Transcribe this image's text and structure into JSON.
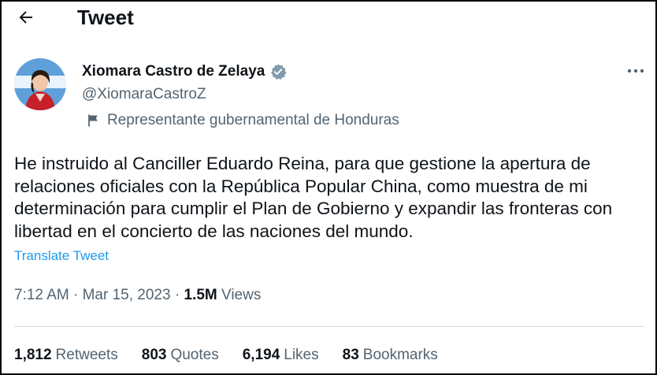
{
  "header": {
    "back_icon": "arrow-left-icon",
    "title": "Tweet"
  },
  "author": {
    "display_name": "Xiomara Castro de Zelaya",
    "handle": "@XiomaraCastroZ",
    "verified_icon": "verified-badge-icon",
    "verified_color": "#829aab",
    "label_icon": "flag-icon",
    "label": "Representante gubernamental de Honduras"
  },
  "more_icon": "more-horizontal-icon",
  "tweet": {
    "text": "He instruido al Canciller Eduardo Reina, para que gestione la apertura de relaciones oficiales con la República Popular China, como muestra de mi determinación para cumplir el Plan de Gobierno y expandir las fronteras con libertad en el concierto de las naciones del mundo.",
    "translate_label": "Translate Tweet",
    "time": "7:12 AM",
    "date": "Mar 15, 2023",
    "views_count": "1.5M",
    "views_label": "Views"
  },
  "stats": [
    {
      "count": "1,812",
      "label": "Retweets"
    },
    {
      "count": "803",
      "label": "Quotes"
    },
    {
      "count": "6,194",
      "label": "Likes"
    },
    {
      "count": "83",
      "label": "Bookmarks"
    }
  ],
  "colors": {
    "text_primary": "#0f1419",
    "text_secondary": "#536471",
    "link": "#1d9bf0",
    "divider": "#cfd9de"
  }
}
